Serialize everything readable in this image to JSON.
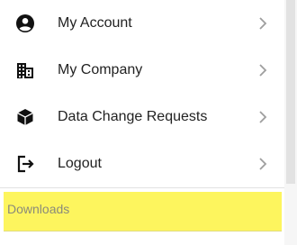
{
  "menu": {
    "items": [
      {
        "label": "My Account",
        "icon": "account-circle-icon"
      },
      {
        "label": "My Company",
        "icon": "company-building-icon"
      },
      {
        "label": "Data Change Requests",
        "icon": "cube-icon"
      },
      {
        "label": "Logout",
        "icon": "logout-icon"
      }
    ],
    "section_label": "Downloads"
  },
  "colors": {
    "highlight": "#fdf55e",
    "text": "#222222",
    "icon": "#111111",
    "chevron": "#9e9e9e"
  }
}
